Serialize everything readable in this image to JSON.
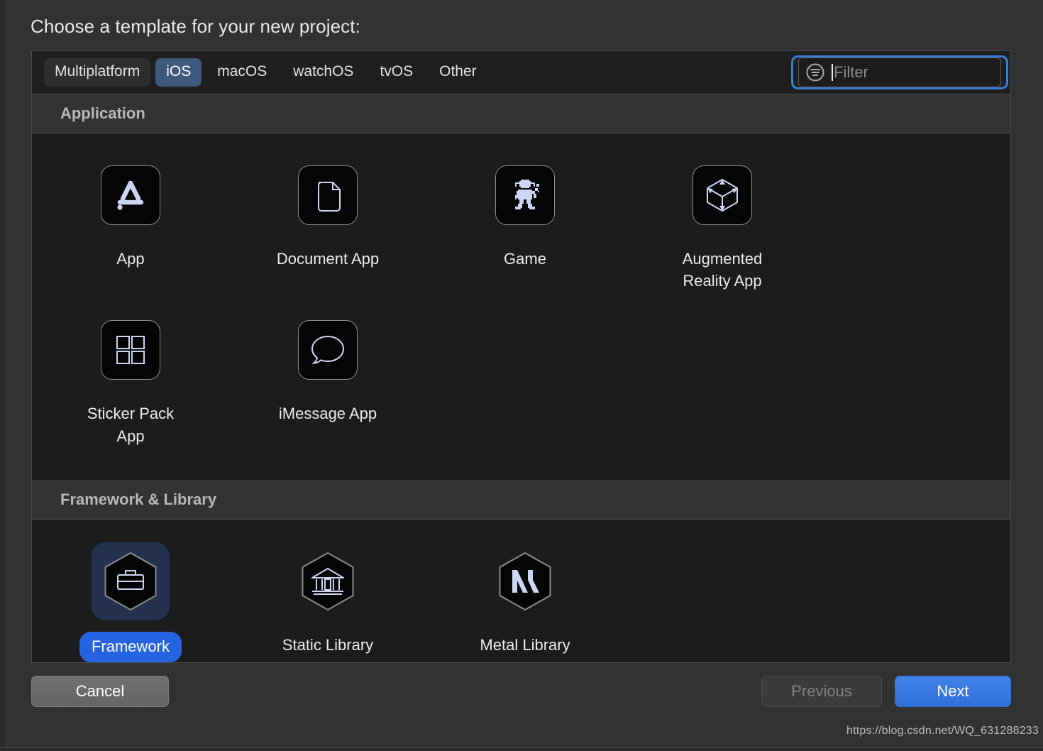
{
  "dialog": {
    "prompt": "Choose a template for your new project:"
  },
  "platform_tabs": [
    {
      "label": "Multiplatform",
      "state": "hovered"
    },
    {
      "label": "iOS",
      "state": "selected"
    },
    {
      "label": "macOS",
      "state": "normal"
    },
    {
      "label": "watchOS",
      "state": "normal"
    },
    {
      "label": "tvOS",
      "state": "normal"
    },
    {
      "label": "Other",
      "state": "normal"
    }
  ],
  "filter": {
    "icon": "filter-icon",
    "placeholder": "Filter",
    "value": "",
    "focused": true
  },
  "sections": [
    {
      "title": "Application",
      "items": [
        {
          "label": "App",
          "icon": "app-store-a-icon",
          "shape": "rounded-square",
          "selected": false
        },
        {
          "label": "Document App",
          "icon": "document-page-icon",
          "shape": "rounded-square",
          "selected": false
        },
        {
          "label": "Game",
          "icon": "pixel-spaceman-icon",
          "shape": "rounded-square",
          "selected": false
        },
        {
          "label": "Augmented Reality App",
          "icon": "wireframe-cube-icon",
          "shape": "rounded-square",
          "selected": false
        },
        {
          "label": "Sticker Pack App",
          "icon": "four-squares-grid-icon",
          "shape": "rounded-square",
          "selected": false
        },
        {
          "label": "iMessage App",
          "icon": "speech-bubble-icon",
          "shape": "rounded-square",
          "selected": false
        }
      ]
    },
    {
      "title": "Framework & Library",
      "items": [
        {
          "label": "Framework",
          "icon": "toolbox-hexagon-icon",
          "shape": "hexagon",
          "selected": true
        },
        {
          "label": "Static Library",
          "icon": "bank-building-hexagon-icon",
          "shape": "hexagon",
          "selected": false
        },
        {
          "label": "Metal Library",
          "icon": "metal-m-hexagon-icon",
          "shape": "hexagon",
          "selected": false
        }
      ]
    }
  ],
  "footer": {
    "cancel_label": "Cancel",
    "previous_label": "Previous",
    "next_label": "Next",
    "previous_disabled": true
  },
  "watermark": "https://blog.csdn.net/WQ_631288233",
  "colors": {
    "accent_blue": "#2563e0",
    "focus_ring": "#3b7fd4",
    "selected_tab": "#3f587d",
    "icon_glyph": "#ccd5f2",
    "panel_bg": "#1c1c1c",
    "dialog_bg": "#323232"
  }
}
